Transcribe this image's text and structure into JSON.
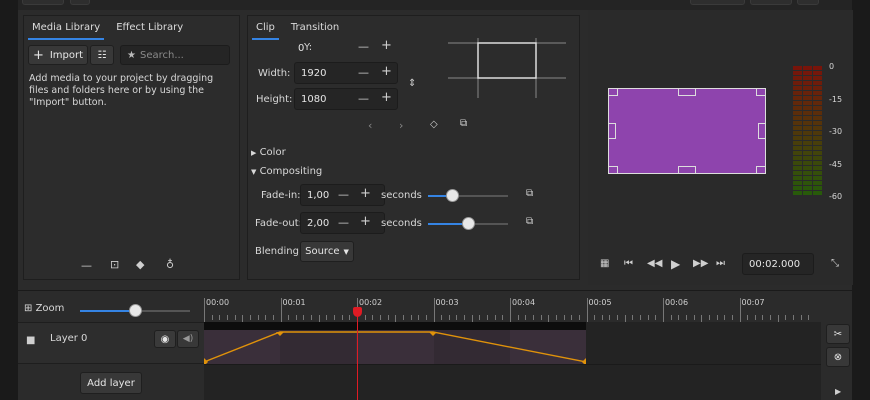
{
  "media_panel": {
    "tabs": [
      "Media Library",
      "Effect Library"
    ],
    "import_label": "Import",
    "search_placeholder": "Search...",
    "hint_text": "Add media to your project by dragging files and folders here or by using the \"Import\" button."
  },
  "clip_panel": {
    "tabs": [
      "Clip",
      "Transition"
    ],
    "y_label": "Y:",
    "y_value": "0",
    "width_label": "Width:",
    "width_value": "1920",
    "height_label": "Height:",
    "height_value": "1080",
    "color_section": "Color",
    "compositing_section": "Compositing",
    "fade_in_label": "Fade-in:",
    "fade_in_value": "1,00",
    "fade_out_label": "Fade-out:",
    "fade_out_value": "2,00",
    "seconds_label": "seconds",
    "blending_label": "Blending:",
    "blending_value": "Source",
    "fade_in_slider": 0.3,
    "fade_out_slider": 0.5
  },
  "viewer": {
    "clip_color": "#8e44ad",
    "meter_labels": [
      "0",
      "-15",
      "-30",
      "-45",
      "-60"
    ],
    "timecode": "00:02.000"
  },
  "timeline": {
    "zoom_label": "Zoom",
    "zoom_level": 0.5,
    "ruler_labels": [
      "00:00",
      "00:01",
      "00:02",
      "00:03",
      "00:04",
      "00:05",
      "00:06",
      "00:07"
    ],
    "layer_name": "Layer 0",
    "add_layer_label": "Add layer",
    "accent": "#e0920a",
    "playhead_color": "#e01b24"
  }
}
